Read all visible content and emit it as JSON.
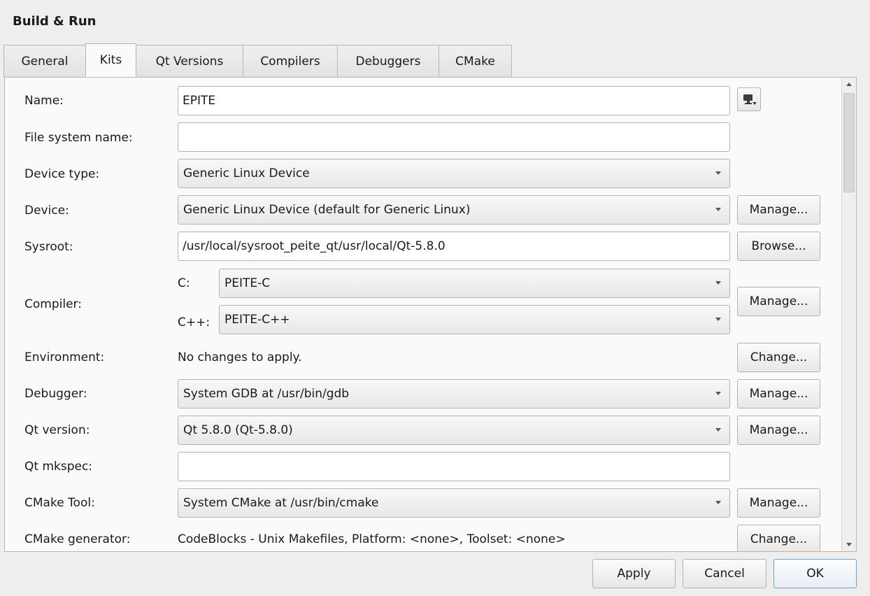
{
  "window": {
    "title": "Build & Run"
  },
  "tabs": [
    {
      "label": "General",
      "active": false
    },
    {
      "label": "Kits",
      "active": true
    },
    {
      "label": "Qt Versions",
      "active": false
    },
    {
      "label": "Compilers",
      "active": false
    },
    {
      "label": "Debuggers",
      "active": false
    },
    {
      "label": "CMake",
      "active": false
    }
  ],
  "kit": {
    "name": {
      "label": "Name:",
      "value": "EPITE",
      "icon": "monitor-icon"
    },
    "file_system_name": {
      "label": "File system name:",
      "value": ""
    },
    "device_type": {
      "label": "Device type:",
      "value": "Generic Linux Device"
    },
    "device": {
      "label": "Device:",
      "value": "Generic Linux Device (default for Generic Linux)",
      "button": "Manage..."
    },
    "sysroot": {
      "label": "Sysroot:",
      "value": "/usr/local/sysroot_peite_qt/usr/local/Qt-5.8.0",
      "button": "Browse..."
    },
    "compiler": {
      "label": "Compiler:",
      "c_label": "C:",
      "c_value": "PEITE-C",
      "cpp_label": "C++:",
      "cpp_value": "PEITE-C++",
      "button": "Manage..."
    },
    "environment": {
      "label": "Environment:",
      "value": "No changes to apply.",
      "button": "Change..."
    },
    "debugger": {
      "label": "Debugger:",
      "value": "System GDB at /usr/bin/gdb",
      "button": "Manage..."
    },
    "qt_version": {
      "label": "Qt version:",
      "value": "Qt 5.8.0 (Qt-5.8.0)",
      "button": "Manage..."
    },
    "qt_mkspec": {
      "label": "Qt mkspec:",
      "value": ""
    },
    "cmake_tool": {
      "label": "CMake Tool:",
      "value": "System CMake at /usr/bin/cmake",
      "button": "Manage..."
    },
    "cmake_generator": {
      "label": "CMake generator:",
      "value": "CodeBlocks - Unix Makefiles, Platform: <none>, Toolset: <none>",
      "button": "Change..."
    }
  },
  "footer": {
    "apply": "Apply",
    "cancel": "Cancel",
    "ok": "OK"
  }
}
